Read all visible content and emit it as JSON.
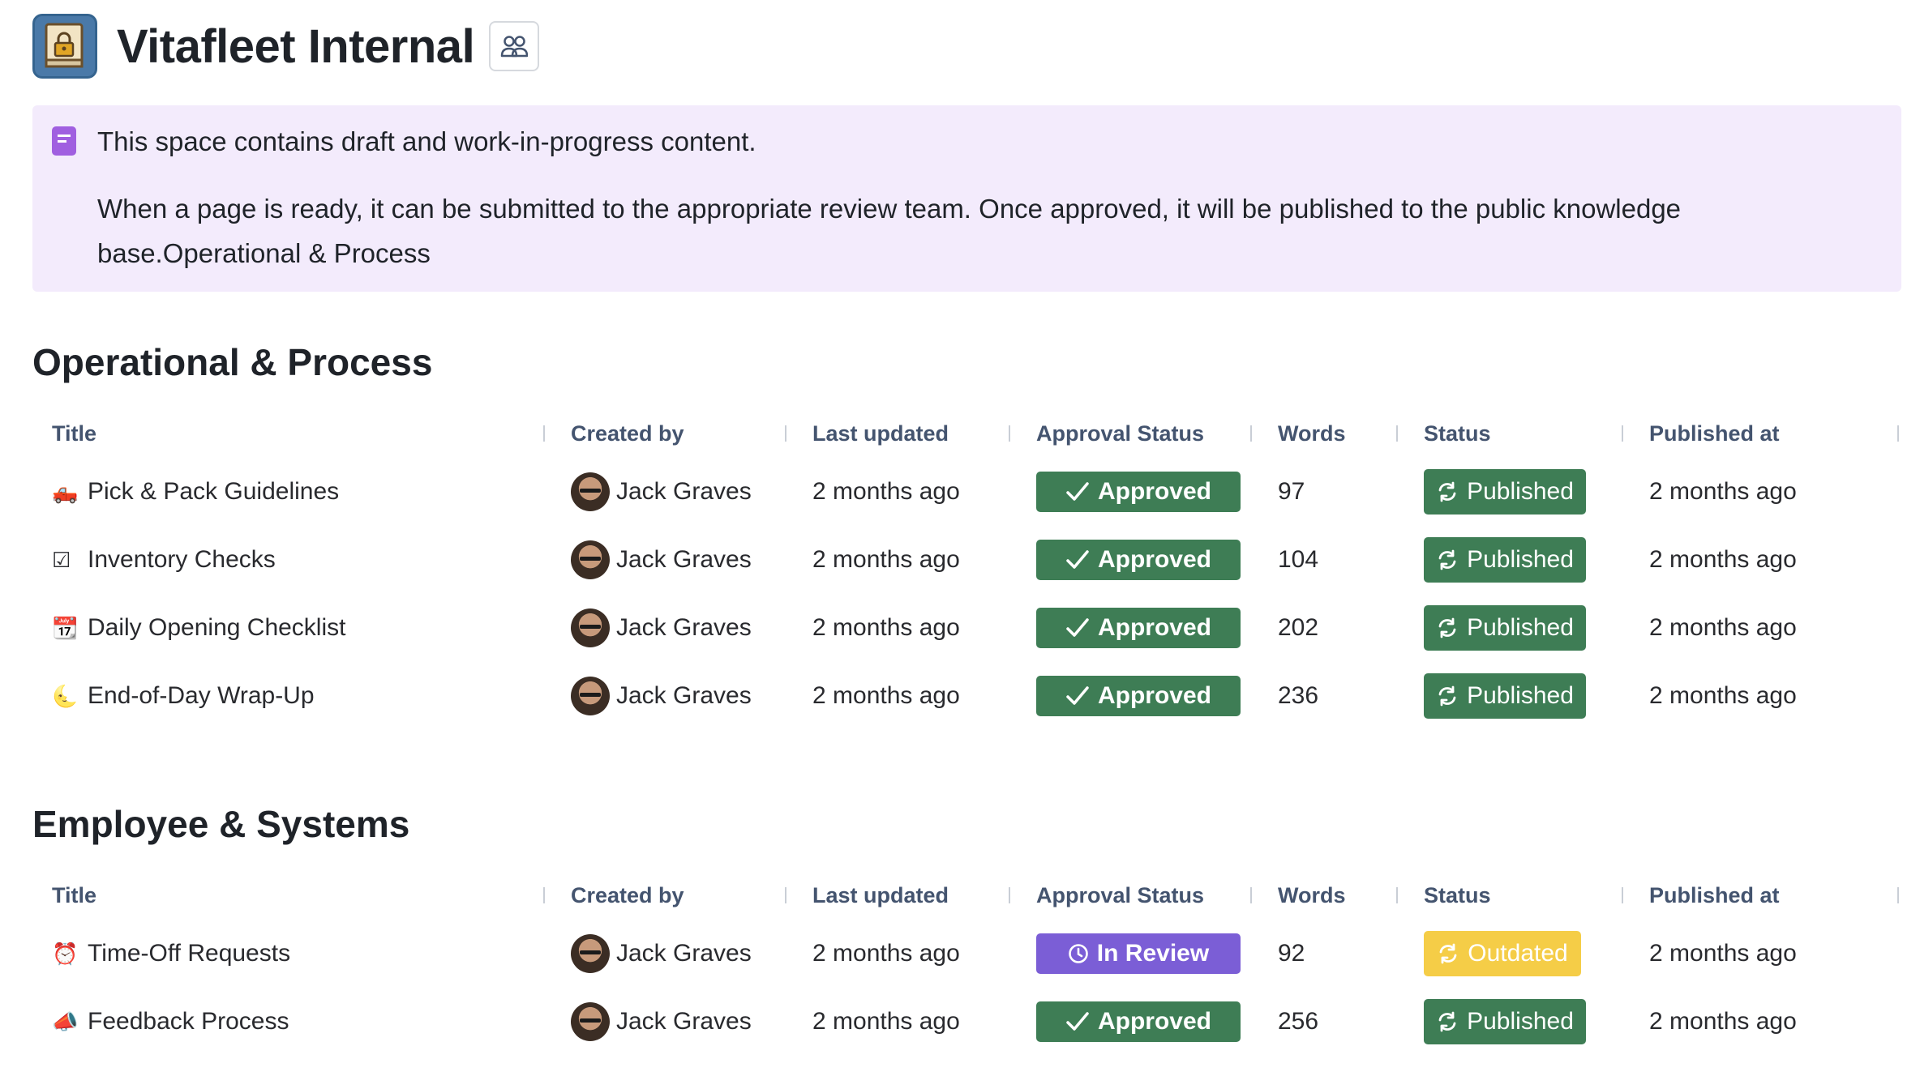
{
  "header": {
    "title": "Vitafleet Internal",
    "space_icon": "locked-book-icon",
    "people_icon": "people-icon"
  },
  "panel": {
    "icon": "note-icon",
    "line1": "This space contains draft and work-in-progress content.",
    "line2": "When a page is ready, it can be submitted to the appropriate review team. Once approved, it will be published to the public knowledge base.Operational & Process"
  },
  "columns": [
    "Title",
    "Created by",
    "Last updated",
    "Approval Status",
    "Words",
    "Status",
    "Published at"
  ],
  "colors": {
    "approved": "#3e7d55",
    "published": "#3e7d55",
    "in_review": "#7b5ed6",
    "outdated": "#f5cd47",
    "panel_bg": "#f3ebfc"
  },
  "sections": [
    {
      "title": "Operational & Process",
      "rows": [
        {
          "emoji": "🛻",
          "title": "Pick & Pack Guidelines",
          "created_by": "Jack Graves",
          "last_updated": "2 months ago",
          "approval": "Approved",
          "approval_kind": "approved",
          "words": "97",
          "status": "Published",
          "status_kind": "published",
          "published_at": "2 months ago"
        },
        {
          "emoji": "☑",
          "title": "Inventory Checks",
          "created_by": "Jack Graves",
          "last_updated": "2 months ago",
          "approval": "Approved",
          "approval_kind": "approved",
          "words": "104",
          "status": "Published",
          "status_kind": "published",
          "published_at": "2 months ago"
        },
        {
          "emoji": "📆",
          "title": "Daily Opening Checklist",
          "created_by": "Jack Graves",
          "last_updated": "2 months ago",
          "approval": "Approved",
          "approval_kind": "approved",
          "words": "202",
          "status": "Published",
          "status_kind": "published",
          "published_at": "2 months ago"
        },
        {
          "emoji": "🌜",
          "title": "End-of-Day Wrap-Up",
          "created_by": "Jack Graves",
          "last_updated": "2 months ago",
          "approval": "Approved",
          "approval_kind": "approved",
          "words": "236",
          "status": "Published",
          "status_kind": "published",
          "published_at": "2 months ago"
        }
      ]
    },
    {
      "title": "Employee & Systems",
      "rows": [
        {
          "emoji": "⏰",
          "title": "Time-Off Requests",
          "created_by": "Jack Graves",
          "last_updated": "2 months ago",
          "approval": "In Review",
          "approval_kind": "in_review",
          "words": "92",
          "status": "Outdated",
          "status_kind": "outdated",
          "published_at": "2 months ago"
        },
        {
          "emoji": "📣",
          "title": "Feedback Process",
          "created_by": "Jack Graves",
          "last_updated": "2 months ago",
          "approval": "Approved",
          "approval_kind": "approved",
          "words": "256",
          "status": "Published",
          "status_kind": "published",
          "published_at": "2 months ago"
        }
      ]
    }
  ]
}
